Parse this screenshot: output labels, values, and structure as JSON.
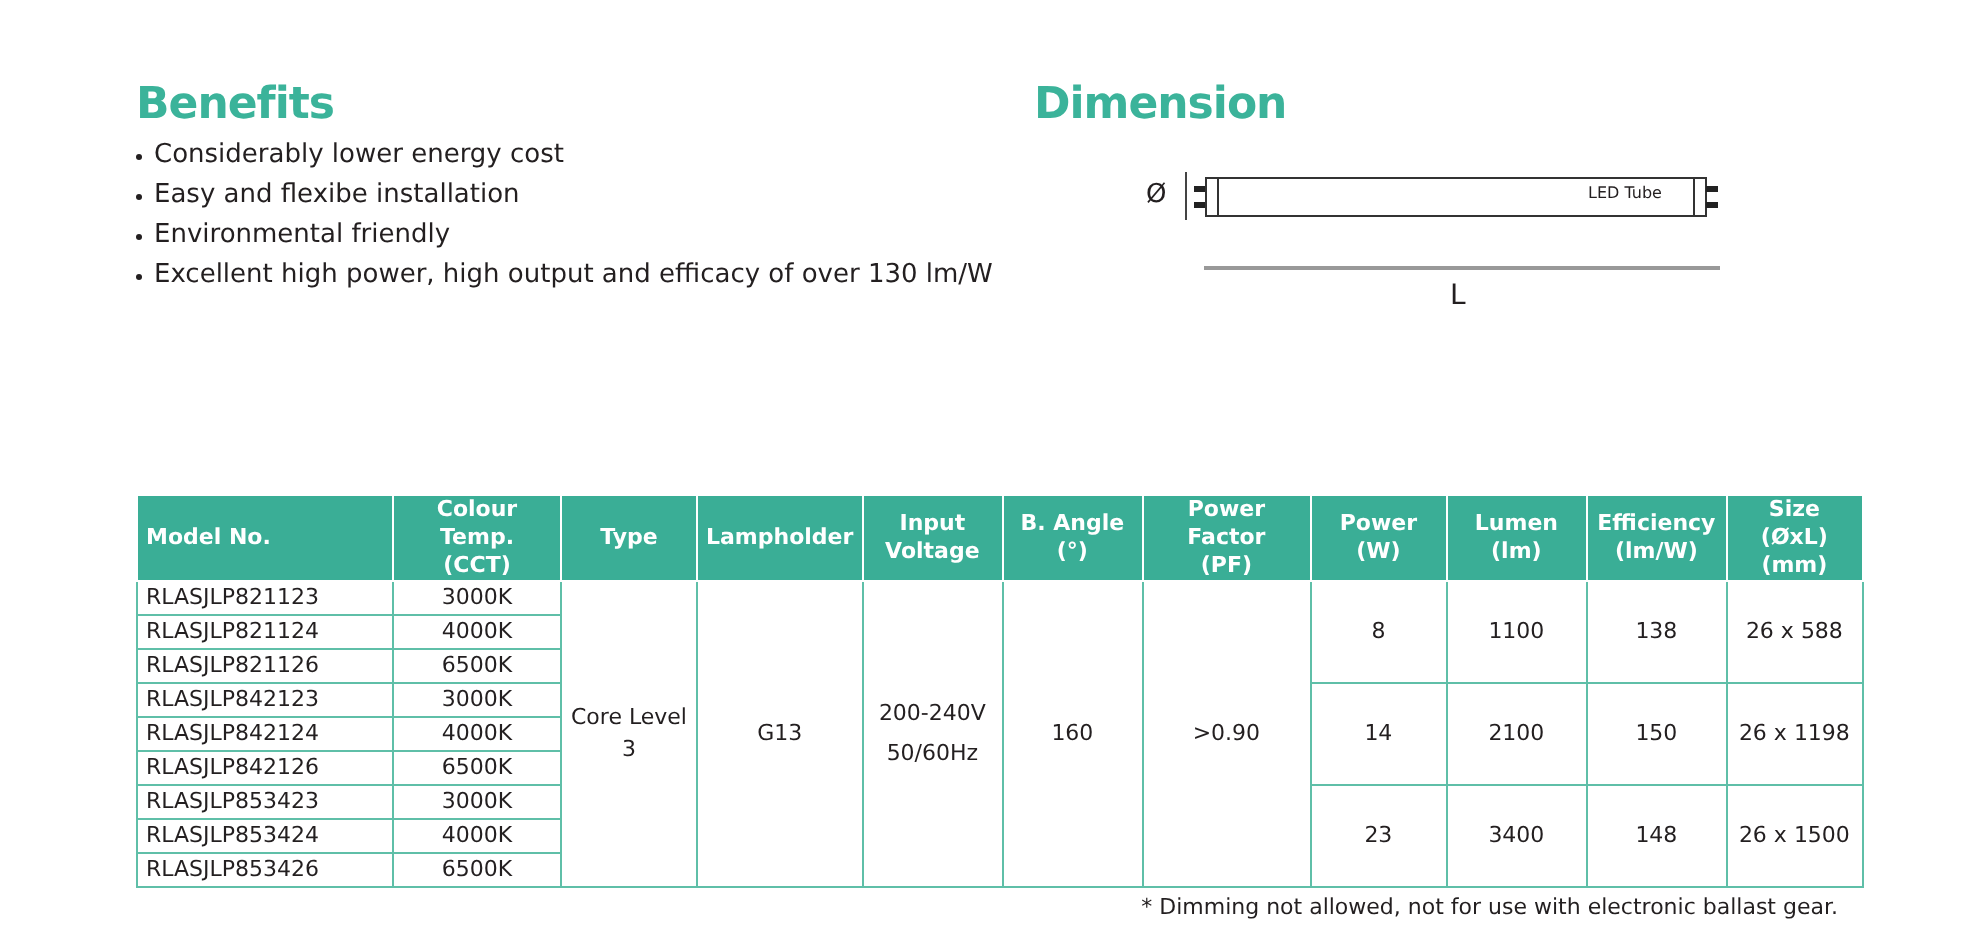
{
  "benefits": {
    "title": "Benefits",
    "items": [
      "Considerably lower energy cost",
      "Easy and flexibe installation",
      "Environmental friendly",
      "Excellent high power, high output and efficacy of over 130 lm/W"
    ]
  },
  "dimension": {
    "title": "Dimension",
    "diameter_label": "Ø",
    "tube_label": "LED Tube",
    "length_label": "L"
  },
  "table": {
    "columns": [
      {
        "label": "Model No."
      },
      {
        "label": "Colour Temp.",
        "unit": "(CCT)"
      },
      {
        "label": "Type"
      },
      {
        "label": "Lampholder"
      },
      {
        "label": "Input",
        "unit": "Voltage"
      },
      {
        "label": "B. Angle",
        "unit": "(°)"
      },
      {
        "label": "Power Factor",
        "unit": "(PF)"
      },
      {
        "label": "Power",
        "unit": "(W)"
      },
      {
        "label": "Lumen",
        "unit": "(lm)"
      },
      {
        "label": "Efficiency",
        "unit": "(lm/W)"
      },
      {
        "label": "Size (ØxL)",
        "unit": "(mm)"
      }
    ],
    "rows": [
      {
        "model": "RLASJLP821123",
        "cct": "3000K"
      },
      {
        "model": "RLASJLP821124",
        "cct": "4000K"
      },
      {
        "model": "RLASJLP821126",
        "cct": "6500K"
      },
      {
        "model": "RLASJLP842123",
        "cct": "3000K"
      },
      {
        "model": "RLASJLP842124",
        "cct": "4000K"
      },
      {
        "model": "RLASJLP842126",
        "cct": "6500K"
      },
      {
        "model": "RLASJLP853423",
        "cct": "3000K"
      },
      {
        "model": "RLASJLP853424",
        "cct": "4000K"
      },
      {
        "model": "RLASJLP853426",
        "cct": "6500K"
      }
    ],
    "type": "Core Level 3",
    "lampholder": "G13",
    "input_voltage": [
      "200-240V",
      "50/60Hz"
    ],
    "beam_angle": "160",
    "power_factor": ">0.90",
    "groups": [
      {
        "power": "8",
        "lumen": "1100",
        "efficiency": "138",
        "size": "26 x 588"
      },
      {
        "power": "14",
        "lumen": "2100",
        "efficiency": "150",
        "size": "26 x 1198"
      },
      {
        "power": "23",
        "lumen": "3400",
        "efficiency": "148",
        "size": "26 x 1500"
      }
    ]
  },
  "footnote": "* Dimming not allowed, not for use with electronic ballast gear."
}
